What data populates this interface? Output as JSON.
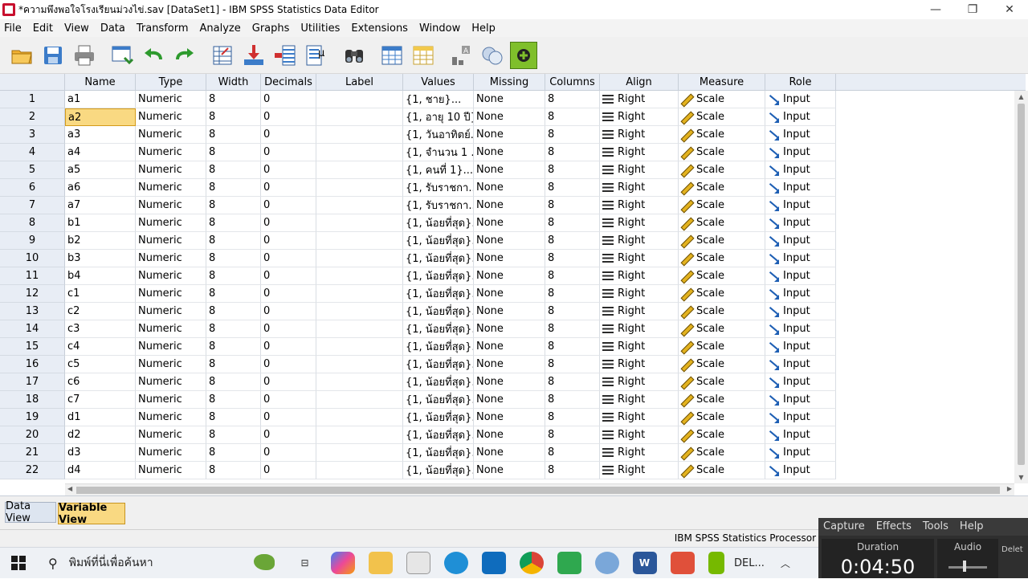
{
  "window": {
    "title": "*ความพึงพอใจโรงเรียนม่วงไข่.sav [DataSet1] - IBM SPSS Statistics Data Editor",
    "min": "—",
    "max": "❐",
    "close": "✕"
  },
  "menu": [
    "File",
    "Edit",
    "View",
    "Data",
    "Transform",
    "Analyze",
    "Graphs",
    "Utilities",
    "Extensions",
    "Window",
    "Help"
  ],
  "toolbar": [
    "open-icon",
    "save-icon",
    "print-icon",
    "dialog-recall-icon",
    "undo-icon",
    "redo-icon",
    "goto-case-icon",
    "goto-variable-icon",
    "variables-icon",
    "descriptive-icon",
    "find-icon",
    "split-file-icon",
    "select-cases-icon",
    "value-labels-icon",
    "use-sets-icon",
    "add-icon"
  ],
  "columns": [
    "Name",
    "Type",
    "Width",
    "Decimals",
    "Label",
    "Values",
    "Missing",
    "Columns",
    "Align",
    "Measure",
    "Role"
  ],
  "rows": [
    {
      "n": "1",
      "name": "a1",
      "type": "Numeric",
      "width": "8",
      "decimals": "0",
      "label": "",
      "values": "{1, ชาย}...",
      "missing": "None",
      "columns": "8",
      "align": "Right",
      "measure": "Scale",
      "role": "Input"
    },
    {
      "n": "2",
      "name": "a2",
      "type": "Numeric",
      "width": "8",
      "decimals": "0",
      "label": "",
      "values": "{1, อายุ 10 ปี}...",
      "missing": "None",
      "columns": "8",
      "align": "Right",
      "measure": "Scale",
      "role": "Input"
    },
    {
      "n": "3",
      "name": "a3",
      "type": "Numeric",
      "width": "8",
      "decimals": "0",
      "label": "",
      "values": "{1, วันอาทิตย์...",
      "missing": "None",
      "columns": "8",
      "align": "Right",
      "measure": "Scale",
      "role": "Input"
    },
    {
      "n": "4",
      "name": "a4",
      "type": "Numeric",
      "width": "8",
      "decimals": "0",
      "label": "",
      "values": "{1, จำนวน 1 ...",
      "missing": "None",
      "columns": "8",
      "align": "Right",
      "measure": "Scale",
      "role": "Input"
    },
    {
      "n": "5",
      "name": "a5",
      "type": "Numeric",
      "width": "8",
      "decimals": "0",
      "label": "",
      "values": "{1, คนที่ 1}...",
      "missing": "None",
      "columns": "8",
      "align": "Right",
      "measure": "Scale",
      "role": "Input"
    },
    {
      "n": "6",
      "name": "a6",
      "type": "Numeric",
      "width": "8",
      "decimals": "0",
      "label": "",
      "values": "{1, รับราชกา...",
      "missing": "None",
      "columns": "8",
      "align": "Right",
      "measure": "Scale",
      "role": "Input"
    },
    {
      "n": "7",
      "name": "a7",
      "type": "Numeric",
      "width": "8",
      "decimals": "0",
      "label": "",
      "values": "{1, รับราชกา...",
      "missing": "None",
      "columns": "8",
      "align": "Right",
      "measure": "Scale",
      "role": "Input"
    },
    {
      "n": "8",
      "name": "b1",
      "type": "Numeric",
      "width": "8",
      "decimals": "0",
      "label": "",
      "values": "{1, น้อยที่สุด}...",
      "missing": "None",
      "columns": "8",
      "align": "Right",
      "measure": "Scale",
      "role": "Input"
    },
    {
      "n": "9",
      "name": "b2",
      "type": "Numeric",
      "width": "8",
      "decimals": "0",
      "label": "",
      "values": "{1, น้อยที่สุด}...",
      "missing": "None",
      "columns": "8",
      "align": "Right",
      "measure": "Scale",
      "role": "Input"
    },
    {
      "n": "10",
      "name": "b3",
      "type": "Numeric",
      "width": "8",
      "decimals": "0",
      "label": "",
      "values": "{1, น้อยที่สุด}...",
      "missing": "None",
      "columns": "8",
      "align": "Right",
      "measure": "Scale",
      "role": "Input"
    },
    {
      "n": "11",
      "name": "b4",
      "type": "Numeric",
      "width": "8",
      "decimals": "0",
      "label": "",
      "values": "{1, น้อยที่สุด}...",
      "missing": "None",
      "columns": "8",
      "align": "Right",
      "measure": "Scale",
      "role": "Input"
    },
    {
      "n": "12",
      "name": "c1",
      "type": "Numeric",
      "width": "8",
      "decimals": "0",
      "label": "",
      "values": "{1, น้อยที่สุด}...",
      "missing": "None",
      "columns": "8",
      "align": "Right",
      "measure": "Scale",
      "role": "Input"
    },
    {
      "n": "13",
      "name": "c2",
      "type": "Numeric",
      "width": "8",
      "decimals": "0",
      "label": "",
      "values": "{1, น้อยที่สุด}...",
      "missing": "None",
      "columns": "8",
      "align": "Right",
      "measure": "Scale",
      "role": "Input"
    },
    {
      "n": "14",
      "name": "c3",
      "type": "Numeric",
      "width": "8",
      "decimals": "0",
      "label": "",
      "values": "{1, น้อยที่สุด}...",
      "missing": "None",
      "columns": "8",
      "align": "Right",
      "measure": "Scale",
      "role": "Input"
    },
    {
      "n": "15",
      "name": "c4",
      "type": "Numeric",
      "width": "8",
      "decimals": "0",
      "label": "",
      "values": "{1, น้อยที่สุด}...",
      "missing": "None",
      "columns": "8",
      "align": "Right",
      "measure": "Scale",
      "role": "Input"
    },
    {
      "n": "16",
      "name": "c5",
      "type": "Numeric",
      "width": "8",
      "decimals": "0",
      "label": "",
      "values": "{1, น้อยที่สุด}...",
      "missing": "None",
      "columns": "8",
      "align": "Right",
      "measure": "Scale",
      "role": "Input"
    },
    {
      "n": "17",
      "name": "c6",
      "type": "Numeric",
      "width": "8",
      "decimals": "0",
      "label": "",
      "values": "{1, น้อยที่สุด}...",
      "missing": "None",
      "columns": "8",
      "align": "Right",
      "measure": "Scale",
      "role": "Input"
    },
    {
      "n": "18",
      "name": "c7",
      "type": "Numeric",
      "width": "8",
      "decimals": "0",
      "label": "",
      "values": "{1, น้อยที่สุด}...",
      "missing": "None",
      "columns": "8",
      "align": "Right",
      "measure": "Scale",
      "role": "Input"
    },
    {
      "n": "19",
      "name": "d1",
      "type": "Numeric",
      "width": "8",
      "decimals": "0",
      "label": "",
      "values": "{1, น้อยที่สุด}...",
      "missing": "None",
      "columns": "8",
      "align": "Right",
      "measure": "Scale",
      "role": "Input"
    },
    {
      "n": "20",
      "name": "d2",
      "type": "Numeric",
      "width": "8",
      "decimals": "0",
      "label": "",
      "values": "{1, น้อยที่สุด}...",
      "missing": "None",
      "columns": "8",
      "align": "Right",
      "measure": "Scale",
      "role": "Input"
    },
    {
      "n": "21",
      "name": "d3",
      "type": "Numeric",
      "width": "8",
      "decimals": "0",
      "label": "",
      "values": "{1, น้อยที่สุด}...",
      "missing": "None",
      "columns": "8",
      "align": "Right",
      "measure": "Scale",
      "role": "Input"
    },
    {
      "n": "22",
      "name": "d4",
      "type": "Numeric",
      "width": "8",
      "decimals": "0",
      "label": "",
      "values": "{1, น้อยที่สุด}...",
      "missing": "None",
      "columns": "8",
      "align": "Right",
      "measure": "Scale",
      "role": "Input"
    }
  ],
  "selected": {
    "row": 1,
    "col": "name"
  },
  "tabs": {
    "data_view": "Data View",
    "variable_view": "Variable View"
  },
  "status": {
    "processor": "IBM SPSS Statistics Processor"
  },
  "recorder": {
    "menu": [
      "Capture",
      "Effects",
      "Tools",
      "Help"
    ],
    "duration_label": "Duration",
    "duration": "0:04:50",
    "audio_label": "Audio",
    "delete_label": "Delet"
  },
  "taskbar": {
    "search_placeholder": "พิมพ์ที่นี่เพื่อค้นหา",
    "running_app": "DEL...",
    "icons": [
      "task-view-icon",
      "copilot-icon",
      "file-explorer-icon",
      "store-icon",
      "edge-icon",
      "outlook-icon",
      "chrome-icon",
      "camtasia-icon",
      "spss-icon",
      "word-icon",
      "camtasia-recorder-icon",
      "nvidia-icon"
    ]
  },
  "colors": {
    "selected_cell": "#f9d982",
    "header_bg": "#e8edf5",
    "active_tab": "#f9d982"
  }
}
